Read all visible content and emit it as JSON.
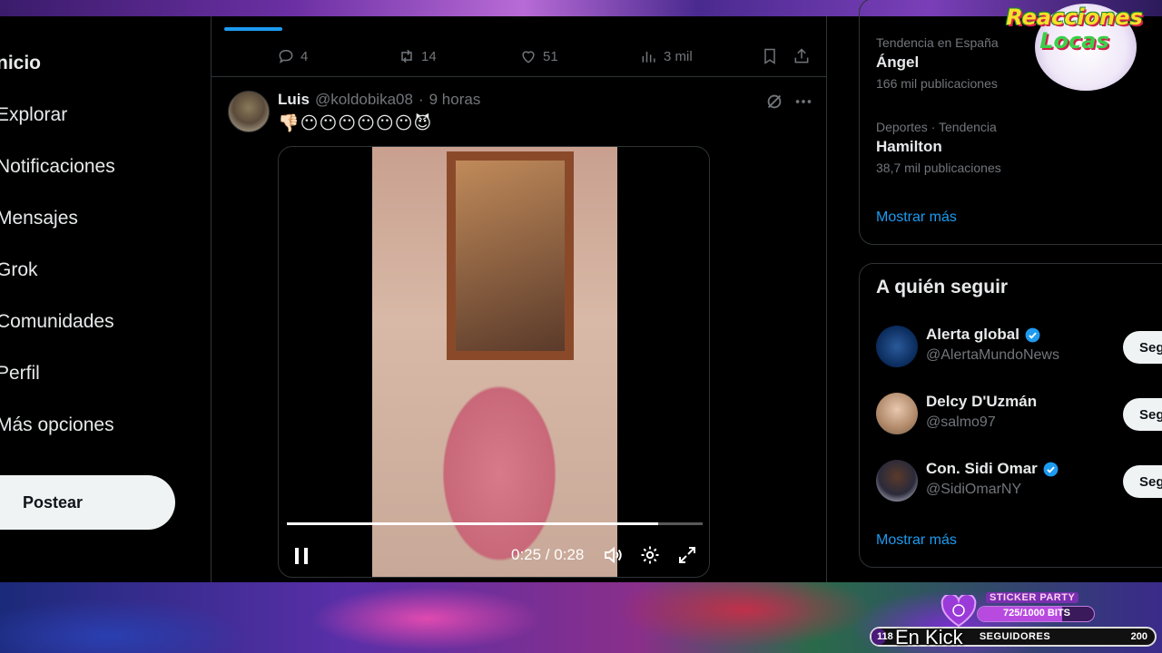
{
  "nav": {
    "items": [
      {
        "label": "nicio",
        "active": true
      },
      {
        "label": "Explorar"
      },
      {
        "label": "Notificaciones"
      },
      {
        "label": "Mensajes"
      },
      {
        "label": "Grok"
      },
      {
        "label": "Comunidades"
      },
      {
        "label": "Perfil"
      },
      {
        "label": "Más opciones"
      }
    ],
    "post_button": "Postear"
  },
  "prev_tweet_actions": {
    "replies": "4",
    "reposts": "14",
    "likes": "51",
    "views": "3 mil"
  },
  "tweet": {
    "name": "Luis",
    "handle": "@koldobika08",
    "dot": "·",
    "time": "9 horas",
    "text": "👎🏻😶😶😶😶😶😶😈",
    "video": {
      "time_display": "0:25 / 0:28",
      "progress": 0.893
    }
  },
  "trends": {
    "items": [
      {
        "meta": "Tendencia en España",
        "title": "Ángel",
        "count": "166 mil publicaciones"
      },
      {
        "meta": "Deportes · Tendencia",
        "title": "Hamilton",
        "count": "38,7 mil publicaciones"
      }
    ],
    "show_more": "Mostrar más"
  },
  "who_to_follow": {
    "title": "A quién seguir",
    "users": [
      {
        "name": "Alerta global",
        "handle": "@AlertaMundoNews",
        "verified": true,
        "button": "Seg"
      },
      {
        "name": "Delcy D'Uzmán",
        "handle": "@salmo97",
        "verified": false,
        "button": "Seg"
      },
      {
        "name": "Con. Sidi Omar",
        "handle": "@SidiOmarNY",
        "verified": true,
        "button": "Seg"
      }
    ],
    "show_more": "Mostrar más"
  },
  "overlay": {
    "logo_line1": "Reacciones",
    "logo_line2": "Locas",
    "sticker_label": "STICKER PARTY",
    "bits_text": "725/1000 BITS",
    "bits_progress": 0.725,
    "kick_min": "118",
    "kick_label": "SEGUIDORES",
    "kick_max": "200",
    "kick_text": "En Kick",
    "kick_progress": 0.05
  },
  "colors": {
    "accent": "#1d9bf0",
    "bg": "#000000",
    "text": "#e7e9ea",
    "muted": "#71767b",
    "verified": "#1d9bf0"
  }
}
